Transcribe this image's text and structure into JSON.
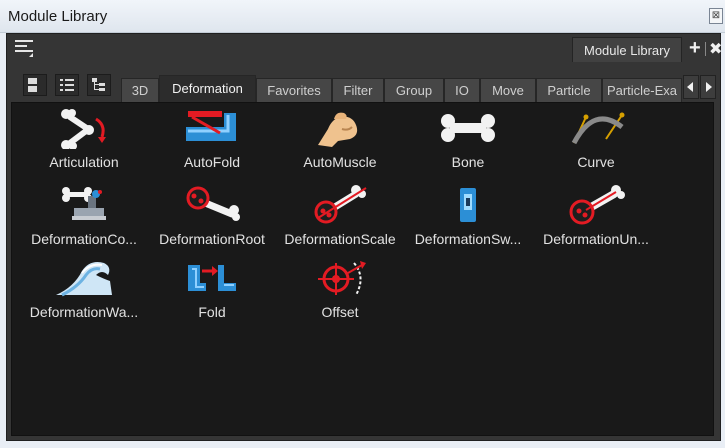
{
  "window": {
    "title": "Module Library",
    "close_glyph": "⊠"
  },
  "panel": {
    "menu_icon": "hamburger-menu-icon",
    "view_tab_label": "Module Library",
    "add_glyph": "+",
    "close_glyph": "✖"
  },
  "toolbar": {
    "buttons": [
      {
        "name": "large-icons-view-icon"
      },
      {
        "name": "list-view-icon"
      },
      {
        "name": "tree-view-icon"
      }
    ]
  },
  "tabs": [
    {
      "label": "3D",
      "active": false
    },
    {
      "label": "Deformation",
      "active": true
    },
    {
      "label": "Favorites",
      "active": false
    },
    {
      "label": "Filter",
      "active": false
    },
    {
      "label": "Group",
      "active": false
    },
    {
      "label": "IO",
      "active": false
    },
    {
      "label": "Move",
      "active": false
    },
    {
      "label": "Particle",
      "active": false
    },
    {
      "label": "Particle-Exa",
      "active": false
    }
  ],
  "modules": [
    {
      "label": "Articulation",
      "icon": "articulation-icon"
    },
    {
      "label": "AutoFold",
      "icon": "autofold-icon"
    },
    {
      "label": "AutoMuscle",
      "icon": "automuscle-icon"
    },
    {
      "label": "Bone",
      "icon": "bone-icon"
    },
    {
      "label": "Curve",
      "icon": "curve-icon"
    },
    {
      "label": "DeformationCo...",
      "icon": "deformation-composite-icon"
    },
    {
      "label": "DeformationRoot",
      "icon": "deformation-root-icon"
    },
    {
      "label": "DeformationScale",
      "icon": "deformation-scale-icon"
    },
    {
      "label": "DeformationSw...",
      "icon": "deformation-switch-icon"
    },
    {
      "label": "DeformationUn...",
      "icon": "deformation-uniform-icon"
    },
    {
      "label": "DeformationWa...",
      "icon": "deformation-wave-icon"
    },
    {
      "label": "Fold",
      "icon": "fold-icon"
    },
    {
      "label": "Offset",
      "icon": "offset-icon"
    }
  ],
  "colors": {
    "accent_red": "#e31b23",
    "accent_blue": "#2c8fd6",
    "panel_bg": "#353535",
    "content_bg": "#191919"
  }
}
